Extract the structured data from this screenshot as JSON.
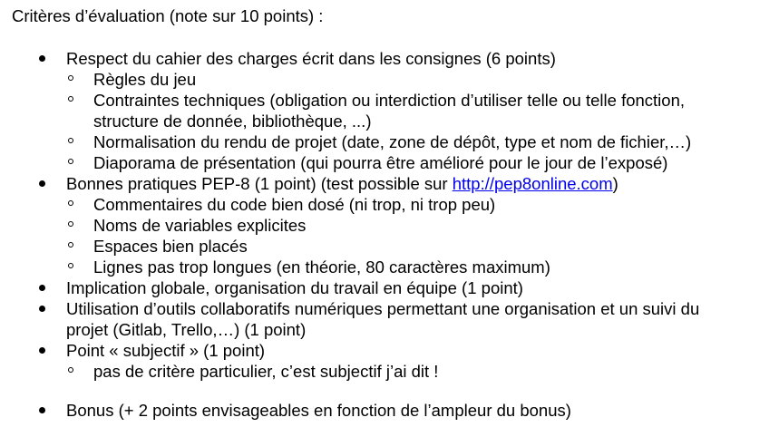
{
  "heading": "Critères d’évaluation (note sur 10 points) :",
  "items": {
    "respect": "Respect du cahier des charges écrit dans les consignes (6 points)",
    "regles": "Règles du jeu",
    "contraintes_1": "Contraintes techniques (obligation ou interdiction d’utiliser telle ou telle fonction,",
    "contraintes_2": "structure de donnée, bibliothèque, ...)",
    "normalisation": "Normalisation du rendu de projet (date, zone de dépôt, type et nom de fichier,…)",
    "diaporama": "Diaporama de présentation (qui pourra être amélioré pour le jour de l’exposé)",
    "pep8_before": "Bonnes pratiques PEP-8 (1 point) (test possible sur ",
    "pep8_link": "http://pep8online.com",
    "pep8_after": ")",
    "commentaires": "Commentaires du code bien dosé (ni trop, ni trop peu)",
    "noms": "Noms de variables explicites",
    "espaces": "Espaces bien placés",
    "lignes": "Lignes pas trop longues (en théorie, 80 caractères maximum)",
    "implication": "Implication globale, organisation du travail en équipe (1 point)",
    "outils_1": "Utilisation d’outils collaboratifs numériques permettant une organisation et un suivi du",
    "outils_2": "projet (Gitlab, Trello,…) (1 point)",
    "subjectif": "Point « subjectif » (1 point)",
    "pas_de_critere": "pas de critère particulier, c’est subjectif j’ai dit !",
    "bonus": "Bonus (+ 2 points envisageables en fonction de l’ampleur du bonus)"
  },
  "colors": {
    "text": "#000000",
    "link": "#0000ee",
    "background": "#ffffff"
  }
}
